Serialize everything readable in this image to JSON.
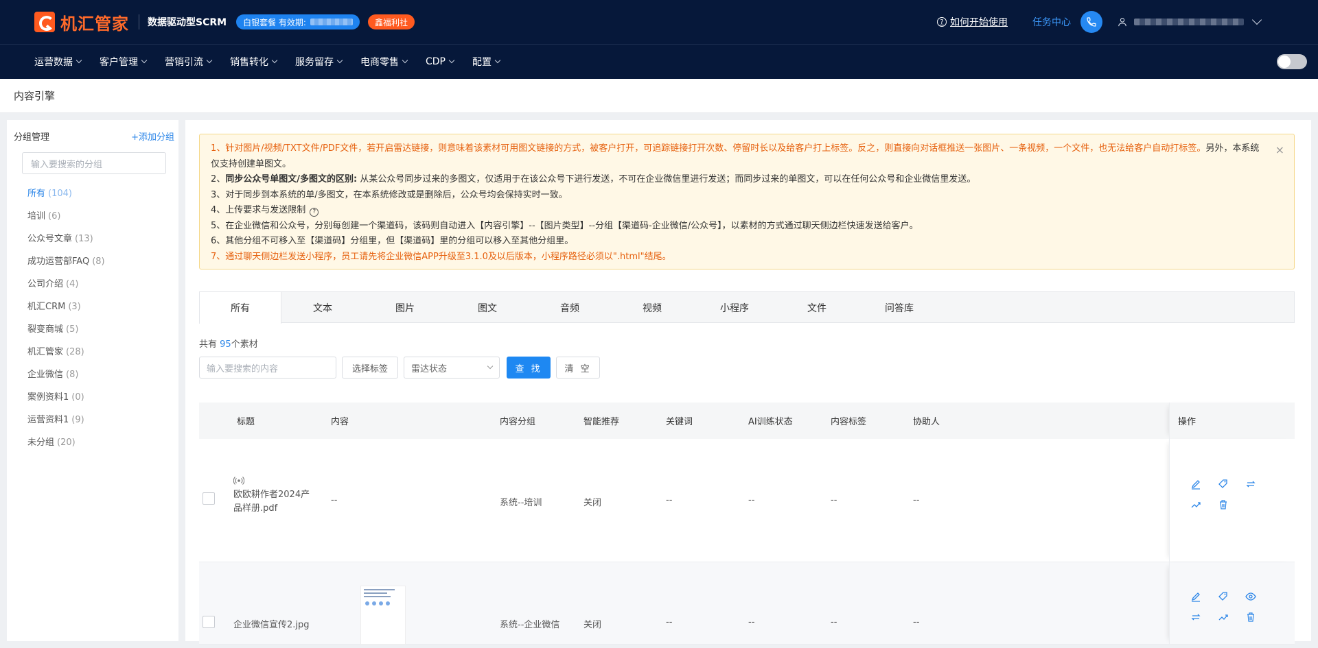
{
  "header": {
    "logo_text": "机汇管家",
    "slogan": "数据驱动型SCRM",
    "package_label": "白银套餐 有效期:",
    "welfare_label": "鑫福利社",
    "help_label": "如何开始使用",
    "task_center": "任务中心"
  },
  "nav": {
    "items": [
      "运营数据",
      "客户管理",
      "营销引流",
      "销售转化",
      "服务留存",
      "电商零售",
      "CDP",
      "配置"
    ]
  },
  "breadcrumb": "内容引擎",
  "sidebar": {
    "title": "分组管理",
    "add_label": "+添加分组",
    "search_placeholder": "输入要搜索的分组",
    "groups": [
      {
        "name": "所有",
        "count": "(104)"
      },
      {
        "name": "培训",
        "count": "(6)"
      },
      {
        "name": "公众号文章",
        "count": "(13)"
      },
      {
        "name": "成功运营部FAQ",
        "count": "(8)"
      },
      {
        "name": "公司介绍",
        "count": "(4)"
      },
      {
        "name": "机汇CRM",
        "count": "(3)"
      },
      {
        "name": "裂变商城",
        "count": "(5)"
      },
      {
        "name": "机汇管家",
        "count": "(28)"
      },
      {
        "name": "企业微信",
        "count": "(8)"
      },
      {
        "name": "案例资料1",
        "count": "(0)"
      },
      {
        "name": "运营资料1",
        "count": "(9)"
      },
      {
        "name": "未分组",
        "count": "(20)"
      }
    ]
  },
  "notice": {
    "line1a": "1、针对图片/视频/TXT文件/PDF文件，若开启雷达链接，则意味着该素材可用图文链接的方式，被客户打开，可追踪链接打开次数、停留时长以及给客户打上标签。反之，则直接向对话框推送一张图片、一条视频，一个文件，也无法给客户自动打标",
    "line1b": "签。",
    "line1c": "另外，本系统仅支持创建单图文。",
    "line2a": "2、",
    "line2b": "同步公众号单图文/多图文的区别:",
    "line2c": " 从某公众号同步过来的多图文，仅适用于在该公众号下进行发送，不可在企业微信里进行发送；而同步过来的单图文，可以在任何公众号和企业微信里发送。",
    "line3": "3、对于同步到本系统的单/多图文，在本系统修改或是删除后，公众号均会保持实时一致。",
    "line4": "4、上传要求与发送限制",
    "line5": "5、在企业微信和公众号，分别每创建一个渠道码，该码则自动进入【内容引擎】--【图片类型】--分组【渠道码-企业微信/公众号】，以素材的方式通过聊天侧边栏快速发送给客户。",
    "line6": "6、其他分组不可移入至【渠道码】分组里，但【渠道码】里的分组可以移入至其他分组里。",
    "line7": "7、通过聊天侧边栏发送小程序，员工请先将企业微信APP升级至3.1.0及以后版本，小程序路径必须以\".html\"结尾。"
  },
  "tabs": [
    "所有",
    "文本",
    "图片",
    "图文",
    "音频",
    "视频",
    "小程序",
    "文件",
    "问答库"
  ],
  "summary": {
    "prefix": "共有",
    "count": "95",
    "suffix": "个素材"
  },
  "filters": {
    "search_placeholder": "输入要搜索的内容",
    "tag_button": "选择标签",
    "radar_select": "雷达状态",
    "search_button": "查 找",
    "clear_button": "清 空"
  },
  "table": {
    "columns": [
      "标题",
      "内容",
      "内容分组",
      "智能推荐",
      "关键词",
      "AI训练状态",
      "内容标签",
      "协助人",
      "操作"
    ],
    "rows": [
      {
        "title_line1": "欧欧耕作者2024产",
        "title_line2": "品样册.pdf",
        "content": "--",
        "group": "系统--培训",
        "recommend": "关闭",
        "keywords": "--",
        "ai_status": "--",
        "tags": "--",
        "assist": "--"
      },
      {
        "title_line1": "企业微信宣传2.jpg",
        "title_line2": "",
        "content": "",
        "group": "系统--企业微信",
        "recommend": "关闭",
        "keywords": "--",
        "ai_status": "--",
        "tags": "--",
        "assist": "--"
      }
    ]
  },
  "colors": {
    "accent": "#1e88f2",
    "brand": "#ff5a1f",
    "header_bg": "#06183a"
  }
}
